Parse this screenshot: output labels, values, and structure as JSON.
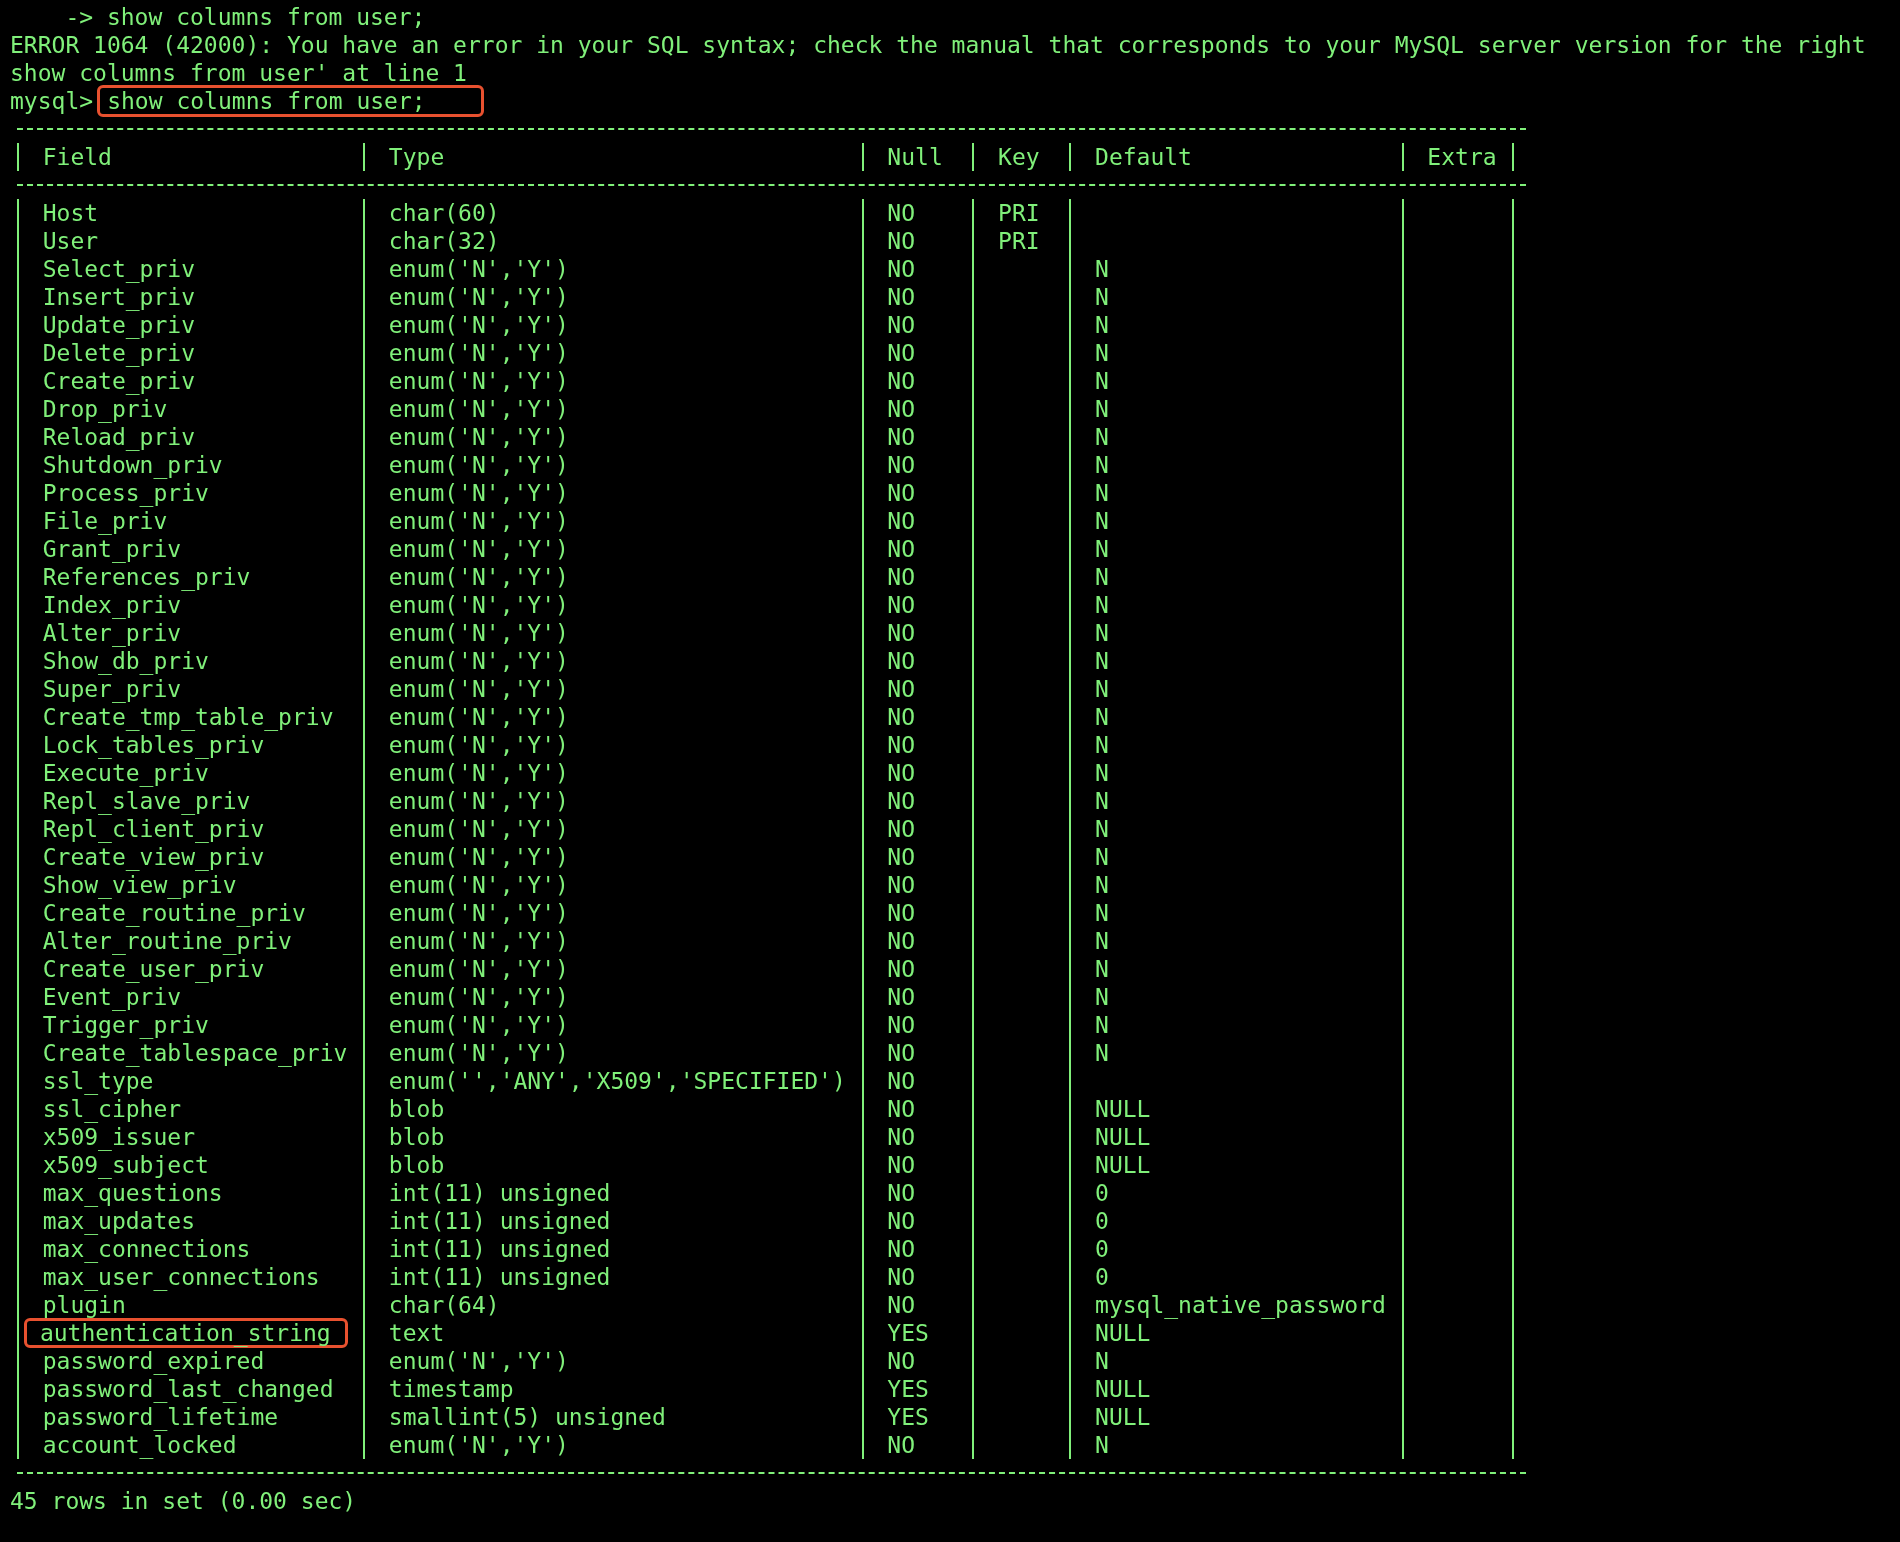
{
  "terminal": {
    "lines": [
      {
        "text": "    -> show columns from user;"
      },
      {
        "text": "ERROR 1064 (42000): You have an error in your SQL syntax; check the manual that corresponds to your MySQL server version for the right"
      },
      {
        "text": "show columns from user' at line 1"
      }
    ],
    "prompt": {
      "label": "mysql>",
      "command": "show columns from user;",
      "highlighted": true
    },
    "table": {
      "columns": [
        {
          "label": "Field"
        },
        {
          "label": "Type"
        },
        {
          "label": "Null"
        },
        {
          "label": "Key"
        },
        {
          "label": "Default"
        },
        {
          "label": "Extra"
        }
      ],
      "rows": [
        {
          "field": "Host",
          "type": "char(60)",
          "null": "NO",
          "key": "PRI",
          "highlighted": false
        },
        {
          "field": "User",
          "type": "char(32)",
          "null": "NO",
          "key": "PRI",
          "highlighted": false
        },
        {
          "field": "Select_priv",
          "type": "enum('N','Y')",
          "null": "NO",
          "default": "N",
          "highlighted": false
        },
        {
          "field": "Insert_priv",
          "type": "enum('N','Y')",
          "null": "NO",
          "default": "N",
          "highlighted": false
        },
        {
          "field": "Update_priv",
          "type": "enum('N','Y')",
          "null": "NO",
          "default": "N",
          "highlighted": false
        },
        {
          "field": "Delete_priv",
          "type": "enum('N','Y')",
          "null": "NO",
          "default": "N",
          "highlighted": false
        },
        {
          "field": "Create_priv",
          "type": "enum('N','Y')",
          "null": "NO",
          "default": "N",
          "highlighted": false
        },
        {
          "field": "Drop_priv",
          "type": "enum('N','Y')",
          "null": "NO",
          "default": "N",
          "highlighted": false
        },
        {
          "field": "Reload_priv",
          "type": "enum('N','Y')",
          "null": "NO",
          "default": "N",
          "highlighted": false
        },
        {
          "field": "Shutdown_priv",
          "type": "enum('N','Y')",
          "null": "NO",
          "default": "N",
          "highlighted": false
        },
        {
          "field": "Process_priv",
          "type": "enum('N','Y')",
          "null": "NO",
          "default": "N",
          "highlighted": false
        },
        {
          "field": "File_priv",
          "type": "enum('N','Y')",
          "null": "NO",
          "default": "N",
          "highlighted": false
        },
        {
          "field": "Grant_priv",
          "type": "enum('N','Y')",
          "null": "NO",
          "default": "N",
          "highlighted": false
        },
        {
          "field": "References_priv",
          "type": "enum('N','Y')",
          "null": "NO",
          "default": "N",
          "highlighted": false
        },
        {
          "field": "Index_priv",
          "type": "enum('N','Y')",
          "null": "NO",
          "default": "N",
          "highlighted": false
        },
        {
          "field": "Alter_priv",
          "type": "enum('N','Y')",
          "null": "NO",
          "default": "N",
          "highlighted": false
        },
        {
          "field": "Show_db_priv",
          "type": "enum('N','Y')",
          "null": "NO",
          "default": "N",
          "highlighted": false
        },
        {
          "field": "Super_priv",
          "type": "enum('N','Y')",
          "null": "NO",
          "default": "N",
          "highlighted": false
        },
        {
          "field": "Create_tmp_table_priv",
          "type": "enum('N','Y')",
          "null": "NO",
          "default": "N",
          "highlighted": false
        },
        {
          "field": "Lock_tables_priv",
          "type": "enum('N','Y')",
          "null": "NO",
          "default": "N",
          "highlighted": false
        },
        {
          "field": "Execute_priv",
          "type": "enum('N','Y')",
          "null": "NO",
          "default": "N",
          "highlighted": false
        },
        {
          "field": "Repl_slave_priv",
          "type": "enum('N','Y')",
          "null": "NO",
          "default": "N",
          "highlighted": false
        },
        {
          "field": "Repl_client_priv",
          "type": "enum('N','Y')",
          "null": "NO",
          "default": "N",
          "highlighted": false
        },
        {
          "field": "Create_view_priv",
          "type": "enum('N','Y')",
          "null": "NO",
          "default": "N",
          "highlighted": false
        },
        {
          "field": "Show_view_priv",
          "type": "enum('N','Y')",
          "null": "NO",
          "default": "N",
          "highlighted": false
        },
        {
          "field": "Create_routine_priv",
          "type": "enum('N','Y')",
          "null": "NO",
          "default": "N",
          "highlighted": false
        },
        {
          "field": "Alter_routine_priv",
          "type": "enum('N','Y')",
          "null": "NO",
          "default": "N",
          "highlighted": false
        },
        {
          "field": "Create_user_priv",
          "type": "enum('N','Y')",
          "null": "NO",
          "default": "N",
          "highlighted": false
        },
        {
          "field": "Event_priv",
          "type": "enum('N','Y')",
          "null": "NO",
          "default": "N",
          "highlighted": false
        },
        {
          "field": "Trigger_priv",
          "type": "enum('N','Y')",
          "null": "NO",
          "default": "N",
          "highlighted": false
        },
        {
          "field": "Create_tablespace_priv",
          "type": "enum('N','Y')",
          "null": "NO",
          "default": "N",
          "highlighted": false
        },
        {
          "field": "ssl_type",
          "type": "enum('','ANY','X509','SPECIFIED')",
          "null": "NO",
          "highlighted": false
        },
        {
          "field": "ssl_cipher",
          "type": "blob",
          "null": "NO",
          "default": "NULL",
          "highlighted": false
        },
        {
          "field": "x509_issuer",
          "type": "blob",
          "null": "NO",
          "default": "NULL",
          "highlighted": false
        },
        {
          "field": "x509_subject",
          "type": "blob",
          "null": "NO",
          "default": "NULL",
          "highlighted": false
        },
        {
          "field": "max_questions",
          "type": "int(11) unsigned",
          "null": "NO",
          "default": "0",
          "highlighted": false
        },
        {
          "field": "max_updates",
          "type": "int(11) unsigned",
          "null": "NO",
          "default": "0",
          "highlighted": false
        },
        {
          "field": "max_connections",
          "type": "int(11) unsigned",
          "null": "NO",
          "default": "0",
          "highlighted": false
        },
        {
          "field": "max_user_connections",
          "type": "int(11) unsigned",
          "null": "NO",
          "default": "0",
          "highlighted": false
        },
        {
          "field": "plugin",
          "type": "char(64)",
          "null": "NO",
          "default": "mysql_native_password",
          "highlighted": false
        },
        {
          "field": "authentication_string",
          "type": "text",
          "null": "YES",
          "default": "NULL",
          "highlighted": true
        },
        {
          "field": "password_expired",
          "type": "enum('N','Y')",
          "null": "NO",
          "default": "N",
          "highlighted": false
        },
        {
          "field": "password_last_changed",
          "type": "timestamp",
          "null": "YES",
          "default": "NULL",
          "highlighted": false
        },
        {
          "field": "password_lifetime",
          "type": "smallint(5) unsigned",
          "null": "YES",
          "default": "NULL",
          "highlighted": false
        },
        {
          "field": "account_locked",
          "type": "enum('N','Y')",
          "null": "NO",
          "default": "N",
          "highlighted": false
        }
      ]
    },
    "footer": "45 rows in set (0.00 sec)"
  }
}
